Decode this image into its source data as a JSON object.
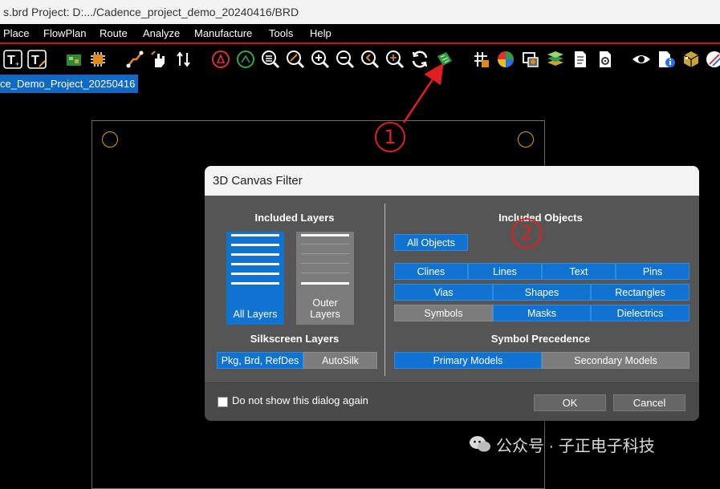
{
  "window": {
    "title": "s.brd  Project: D:.../Cadence_project_demo_20240416/BRD"
  },
  "menu": {
    "items": [
      "Place",
      "FlowPlan",
      "Route",
      "Analyze",
      "Manufacture",
      "Tools",
      "Help"
    ]
  },
  "toolbar": {
    "icons": [
      "text-add-icon",
      "text-edit-icon",
      "board-icon",
      "chip-icon",
      "route-icon",
      "hand-icon",
      "swap-icon",
      "drc-icon",
      "unrats-icon",
      "zoom-fit-icon",
      "zoom-select-icon",
      "zoom-in-icon",
      "zoom-out-icon",
      "zoom-world-icon",
      "zoom-center-icon",
      "redraw-icon",
      "3d-canvas-icon",
      "grid-icon",
      "color-icon",
      "shadow-icon",
      "layers-icon",
      "report-icon",
      "settings-doc-icon",
      "visibility-icon",
      "info-icon",
      "3d-box-icon",
      "paint-icon"
    ]
  },
  "tab": {
    "label": "ce_Demo_Project_20250416"
  },
  "dialog": {
    "title": "3D Canvas Filter",
    "included_layers": {
      "title": "Included Layers",
      "all_layers": "All Layers",
      "outer_layers": "Outer Layers"
    },
    "silkscreen": {
      "title": "Silkscreen Layers",
      "pkg": "Pkg, Brd, RefDes",
      "autosilk": "AutoSilk"
    },
    "included_objects": {
      "title": "Included Objects",
      "all_objects": "All Objects",
      "clines": "Clines",
      "lines": "Lines",
      "text": "Text",
      "pins": "Pins",
      "vias": "Vias",
      "shapes": "Shapes",
      "rectangles": "Rectangles",
      "symbols": "Symbols",
      "masks": "Masks",
      "dielectrics": "Dielectrics"
    },
    "precedence": {
      "title": "Symbol Precedence",
      "primary": "Primary Models",
      "secondary": "Secondary Models"
    },
    "footer": {
      "checkbox_label": "Do not show this dialog again",
      "ok": "OK",
      "cancel": "Cancel"
    }
  },
  "annotations": {
    "marker1": "1",
    "marker2": "2"
  },
  "watermark": {
    "text": "公众号 · 子正电子科技"
  },
  "colors": {
    "accent_blue": "#1073d1",
    "annotation_red": "#e02020",
    "menu_border_red": "#c1121f"
  }
}
